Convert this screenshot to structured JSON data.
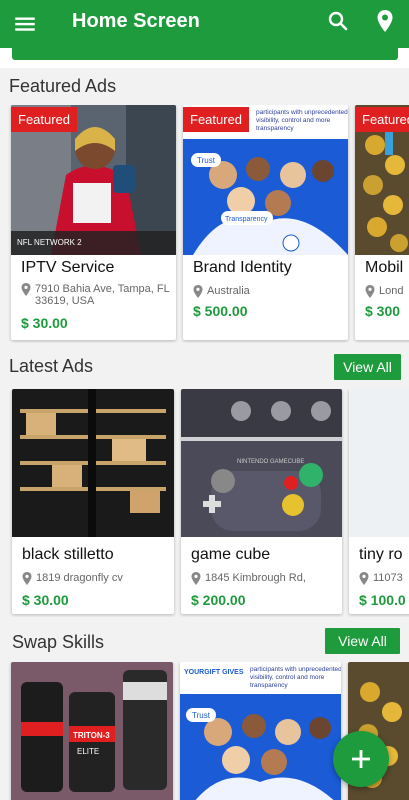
{
  "appbar": {
    "title": "Home Screen",
    "menu_icon": "menu-icon",
    "search_icon": "search-icon",
    "location_icon": "location-pin-icon"
  },
  "featured": {
    "title": "Featured Ads",
    "items": [
      {
        "badge": "Featured",
        "title": "IPTV  Service",
        "location": "7910 Bahia Ave, Tampa, FL 33619, USA",
        "price": "$ 30.00",
        "image": "football-player-interview"
      },
      {
        "badge": "Featured",
        "title": "Brand Identity",
        "location": "Australia",
        "price": "$ 500.00",
        "image": "group-people-brochure"
      },
      {
        "badge": "Featured",
        "title": "Mobil",
        "location": "Lond",
        "price": "$ 300",
        "image": "coins-arcade"
      }
    ]
  },
  "latest": {
    "title": "Latest Ads",
    "view_all": "View All",
    "items": [
      {
        "title": "black stilletto",
        "location": "1819 dragonfly cv",
        "price": "$ 30.00",
        "image": "black-strappy-shoes"
      },
      {
        "title": "game cube",
        "location": "1845 Kimbrough Rd,",
        "price": "$ 200.00",
        "image": "gamecube-controller"
      },
      {
        "title": "tiny ro",
        "location": "11073",
        "price": "$ 100.0",
        "image": "blank"
      }
    ]
  },
  "swap": {
    "title": "Swap Skills",
    "view_all": "View All",
    "items": [
      {
        "image": "supplement-bottles"
      },
      {
        "image": "group-people-brochure",
        "brand": "YOURGIFT GIVES"
      },
      {
        "image": "coins-arcade"
      }
    ]
  },
  "brochure": {
    "headline": "participants with unprecedented visibility, control and more transparency",
    "trust": "Trust",
    "transparency": "Transparency"
  },
  "fab": {
    "icon": "plus-icon"
  },
  "colors": {
    "primary": "#1e9b3c",
    "badge": "#e02020"
  }
}
